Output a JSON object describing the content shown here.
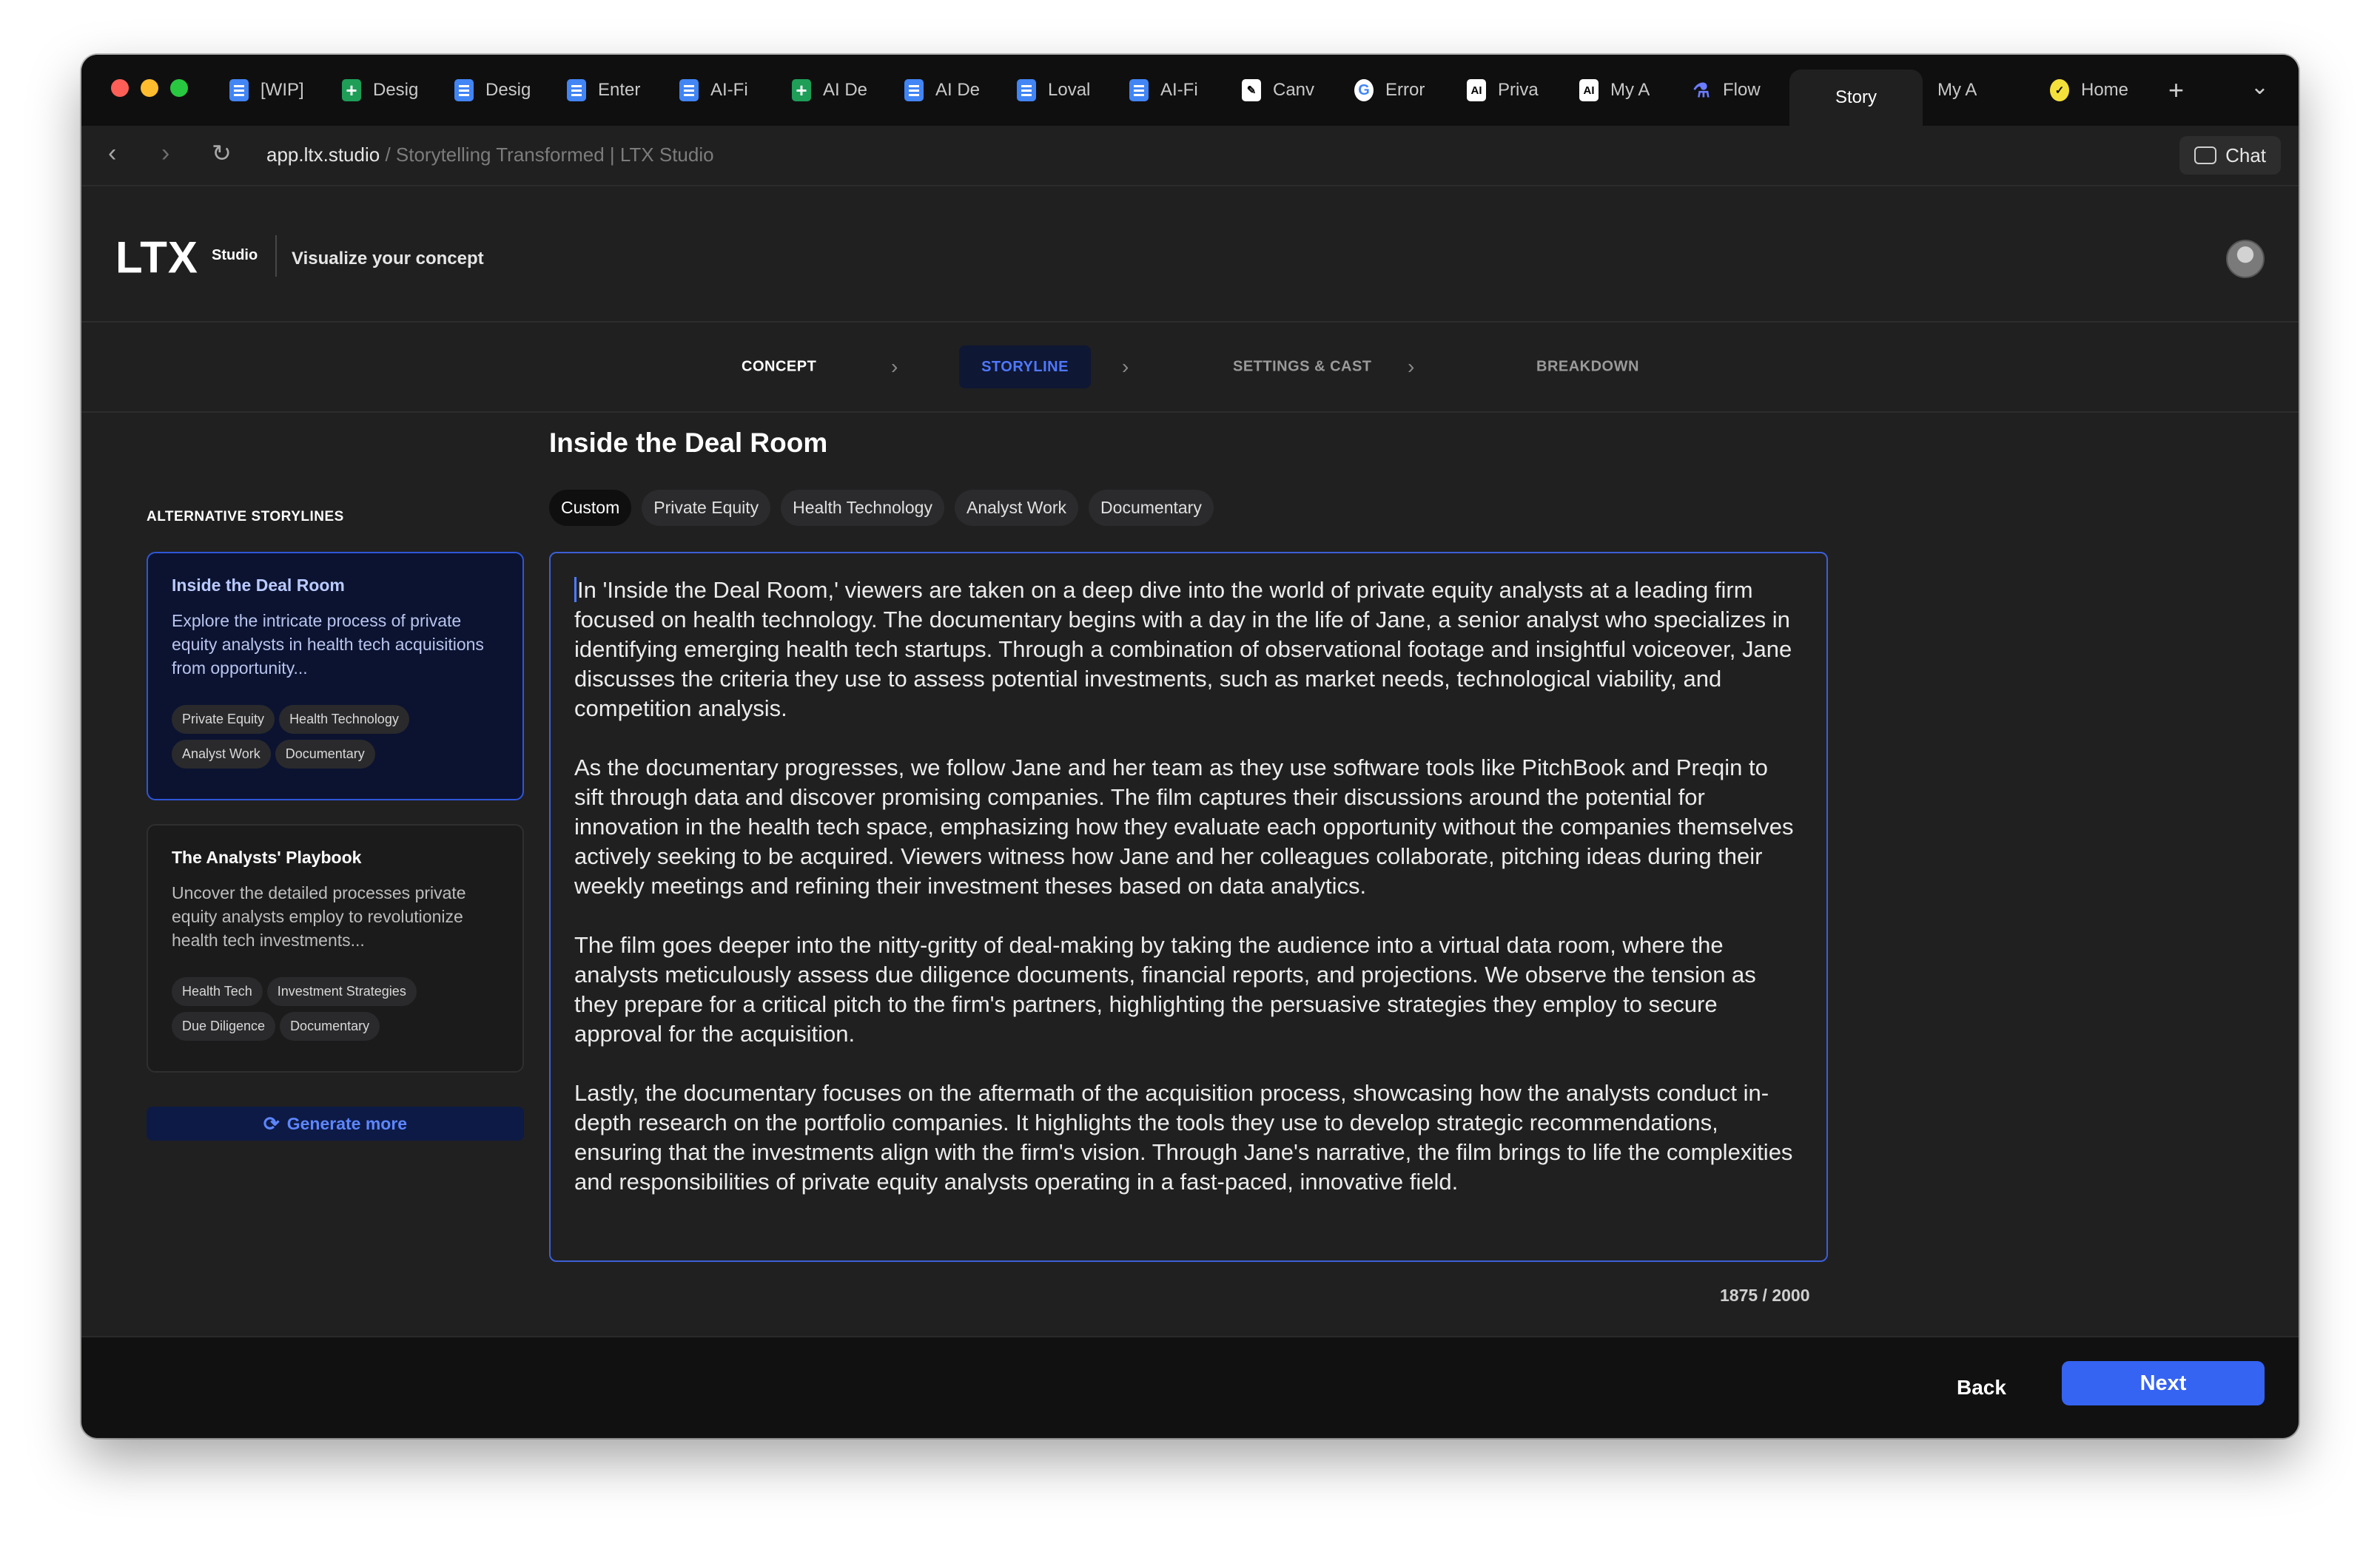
{
  "browser": {
    "tabs": [
      {
        "title": "[WIP]",
        "icon": "doc-icon"
      },
      {
        "title": "Desig",
        "icon": "sheet-icon"
      },
      {
        "title": "Desig",
        "icon": "doc-icon"
      },
      {
        "title": "Enter",
        "icon": "doc-icon"
      },
      {
        "title": "AI-Fi",
        "icon": "doc-icon"
      },
      {
        "title": "AI De",
        "icon": "sheet-icon"
      },
      {
        "title": "AI De",
        "icon": "doc-icon"
      },
      {
        "title": "Loval",
        "icon": "doc-icon"
      },
      {
        "title": "AI-Fi",
        "icon": "doc-icon"
      },
      {
        "title": "Canv",
        "icon": "canva-icon"
      },
      {
        "title": "Error",
        "icon": "google-icon"
      },
      {
        "title": "Priva",
        "icon": "ai-icon"
      },
      {
        "title": "My A",
        "icon": "ai-icon"
      },
      {
        "title": "Flow",
        "icon": "flask-icon"
      },
      {
        "title": "Story",
        "icon": "none",
        "active": true
      },
      {
        "title": "My A",
        "icon": "none"
      },
      {
        "title": "Home",
        "icon": "home-icon"
      }
    ],
    "url_host": "app.ltx.studio",
    "url_rest": " / Storytelling Transformed | LTX Studio",
    "chat_label": "Chat"
  },
  "header": {
    "logo": "LTX",
    "logo_sub": "Studio",
    "tagline": "Visualize your concept"
  },
  "steps": {
    "concept": "CONCEPT",
    "storyline": "STORYLINE",
    "settings": "SETTINGS & CAST",
    "breakdown": "BREAKDOWN"
  },
  "sidebar": {
    "title": "ALTERNATIVE STORYLINES",
    "cards": [
      {
        "title": "Inside the Deal Room",
        "description": "Explore the intricate process of private equity analysts in health tech acquisitions from opportunity...",
        "tags": [
          "Private Equity",
          "Health Technology",
          "Analyst Work",
          "Documentary"
        ]
      },
      {
        "title": "The Analysts' Playbook",
        "description": "Uncover the detailed processes private equity analysts employ to revolutionize health tech investments...",
        "tags": [
          "Health Tech",
          "Investment Strategies",
          "Due Diligence",
          "Documentary"
        ]
      }
    ],
    "generate_label": "Generate more"
  },
  "main": {
    "title": "Inside the Deal Room",
    "tags": [
      "Custom",
      "Private Equity",
      "Health Technology",
      "Analyst Work",
      "Documentary"
    ],
    "paragraphs": [
      "In 'Inside the Deal Room,' viewers are taken on a deep dive into the world of private equity analysts at a leading firm focused on health technology. The documentary begins with a day in the life of Jane, a senior analyst who specializes in identifying emerging health tech startups. Through a combination of observational footage and insightful voiceover, Jane discusses the criteria they use to assess potential investments, such as market needs, technological viability, and competition analysis.",
      "As the documentary progresses, we follow Jane and her team as they use software tools like PitchBook and Preqin to sift through data and discover promising companies. The film captures their discussions around the potential for innovation in the health tech space, emphasizing how they evaluate each opportunity without the companies themselves actively seeking to be acquired. Viewers witness how Jane and her colleagues collaborate, pitching ideas during their weekly meetings and refining their investment theses based on data analytics.",
      "The film goes deeper into the nitty-gritty of deal-making by taking the audience into a virtual data room, where the analysts meticulously assess due diligence documents, financial reports, and projections. We observe the tension as they prepare for a critical pitch to the firm's partners, highlighting the persuasive strategies they employ to secure approval for the acquisition.",
      "Lastly, the documentary focuses on the aftermath of the acquisition process, showcasing how the analysts conduct in-depth research on the portfolio companies. It highlights the tools they use to develop strategic recommendations, ensuring that the investments align with the firm's vision. Through Jane's narrative, the film brings to life the complexities and responsibilities of private equity analysts operating in a fast-paced, innovative field."
    ],
    "counter": "1875 / 2000"
  },
  "footer": {
    "back_label": "Back",
    "next_label": "Next"
  },
  "colors": {
    "accent": "#3563f2",
    "background": "#202021"
  }
}
